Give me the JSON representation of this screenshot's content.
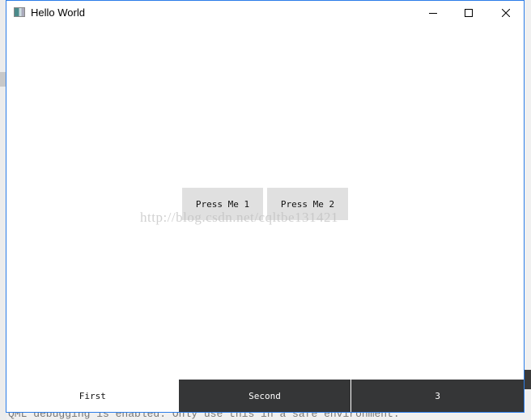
{
  "window": {
    "title": "Hello World",
    "controls": {
      "minimize": "minimize-icon",
      "maximize": "maximize-icon",
      "close": "close-icon"
    }
  },
  "buttons": [
    {
      "label": "Press Me 1"
    },
    {
      "label": "Press Me 2"
    }
  ],
  "watermark": "http://blog.csdn.net/cqltbe131421",
  "tabs": [
    {
      "label": "First",
      "active": true
    },
    {
      "label": "Second",
      "active": false
    },
    {
      "label": "3",
      "active": false
    }
  ],
  "console": {
    "message": "QML debugging is enabled. Only use this in a safe environment."
  },
  "colors": {
    "tab_inactive_bg": "#353637",
    "window_border": "#2b7de9",
    "button_bg": "#e0e0e0"
  }
}
